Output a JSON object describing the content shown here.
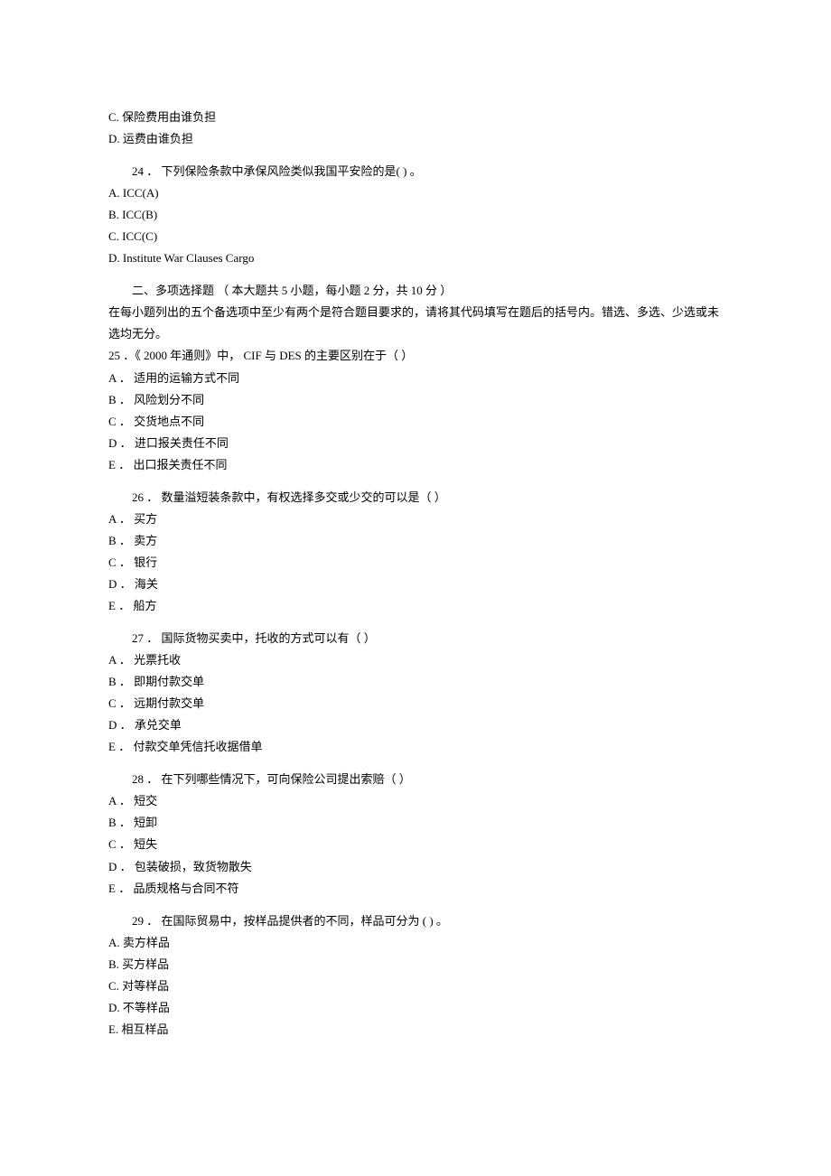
{
  "q23_continued": {
    "C": "C. 保险费用由谁负担",
    "D": "D. 运费由谁负担"
  },
  "q24": {
    "stem": "24 ． 下列保险条款中承保风险类似我国平安险的是(  ) 。",
    "A": "A. ICC(A)",
    "B": "B. ICC(B)",
    "C": "C. ICC(C)",
    "D": "D. Institute War Clauses Cargo"
  },
  "section2": {
    "title": "二、多项选择题 （ 本大题共 5 小题，每小题 2 分，共 10 分 ）",
    "instructions": "在每小题列出的五个备选项中至少有两个是符合题目要求的，请将其代码填写在题后的括号内。错选、多选、少选或未选均无分。"
  },
  "q25": {
    "stem": "25 ．《 2000 年通则》中，  CIF 与 DES 的主要区别在于（ ）",
    "A": "A ． 适用的运输方式不同",
    "B": "B ． 风险划分不同",
    "C": "C ． 交货地点不同",
    "D": "D ． 进口报关责任不同",
    "E": "E ． 出口报关责任不同"
  },
  "q26": {
    "stem": "26 ． 数量溢短装条款中，有权选择多交或少交的可以是（ ）",
    "A": "A ． 买方",
    "B": "B ． 卖方",
    "C": "C ． 银行",
    "D": "D ． 海关",
    "E": "E ． 船方"
  },
  "q27": {
    "stem": "27 ． 国际货物买卖中，托收的方式可以有（ ）",
    "A": "A ． 光票托收",
    "B": "B ． 即期付款交单",
    "C": "C ． 远期付款交单",
    "D": "D ． 承兑交单",
    "E": "E ． 付款交单凭信托收据借单"
  },
  "q28": {
    "stem": "28 ． 在下列哪些情况下，可向保险公司提出索赔（ ）",
    "A": "A ． 短交",
    "B": "B ． 短卸",
    "C": "C ． 短失",
    "D": "D ． 包装破损，致货物散失",
    "E": "E ． 品质规格与合同不符"
  },
  "q29": {
    "stem": "29 ． 在国际贸易中，按样品提供者的不同，样品可分为 (  ) 。",
    "A": "A. 卖方样品",
    "B": "B. 买方样品",
    "C": "C. 对等样品",
    "D": "D. 不等样品",
    "E": "E. 相互样品"
  }
}
